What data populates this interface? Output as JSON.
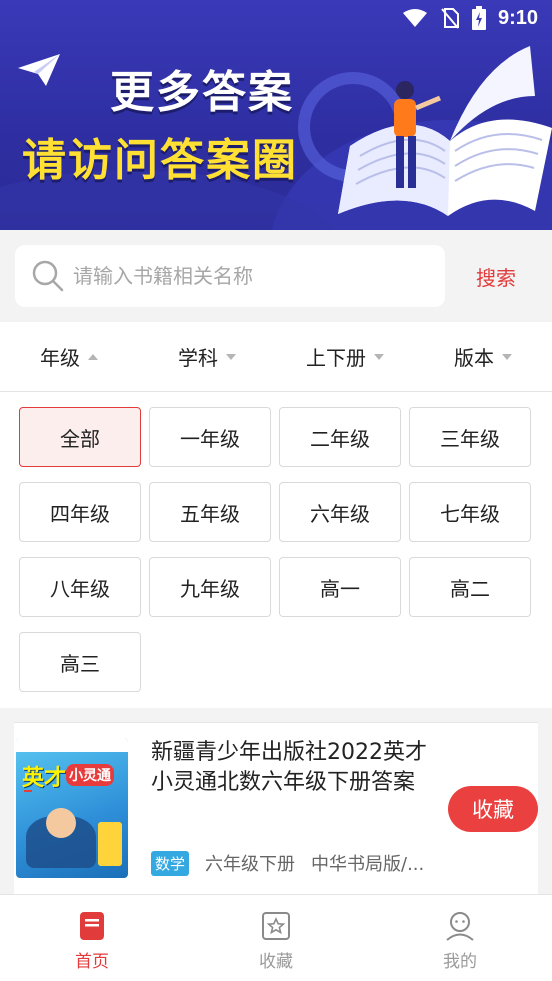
{
  "status_bar": {
    "time": "9:10"
  },
  "banner": {
    "line1": "更多答案",
    "line2": "请访问答案圈",
    "accent_color": "#ffe033",
    "background_color": "#3a39b8"
  },
  "search": {
    "placeholder": "请输入书籍相关名称",
    "value": "",
    "button_label": "搜索"
  },
  "filters": [
    {
      "label": "年级",
      "open": true
    },
    {
      "label": "学科",
      "open": false
    },
    {
      "label": "上下册",
      "open": false
    },
    {
      "label": "版本",
      "open": false
    }
  ],
  "grades": {
    "selected": "全部",
    "options": [
      "全部",
      "一年级",
      "二年级",
      "三年级",
      "四年级",
      "五年级",
      "六年级",
      "七年级",
      "八年级",
      "九年级",
      "高一",
      "高二",
      "高三"
    ]
  },
  "book": {
    "title": "新疆青少年出版社2022英才小灵通北数六年级下册答案",
    "subject": "数学",
    "grade": "六年级下册",
    "edition": "中华书局版/...",
    "favorite_label": "收藏",
    "cover_title": "英才",
    "cover_subtitle": "小灵通"
  },
  "tabs": [
    {
      "label": "首页",
      "icon": "home-book-icon",
      "active": true
    },
    {
      "label": "收藏",
      "icon": "star-box-icon",
      "active": false
    },
    {
      "label": "我的",
      "icon": "user-icon",
      "active": false
    }
  ],
  "colors": {
    "accent_red": "#e23b3b",
    "subject_blue": "#34a8e0"
  }
}
